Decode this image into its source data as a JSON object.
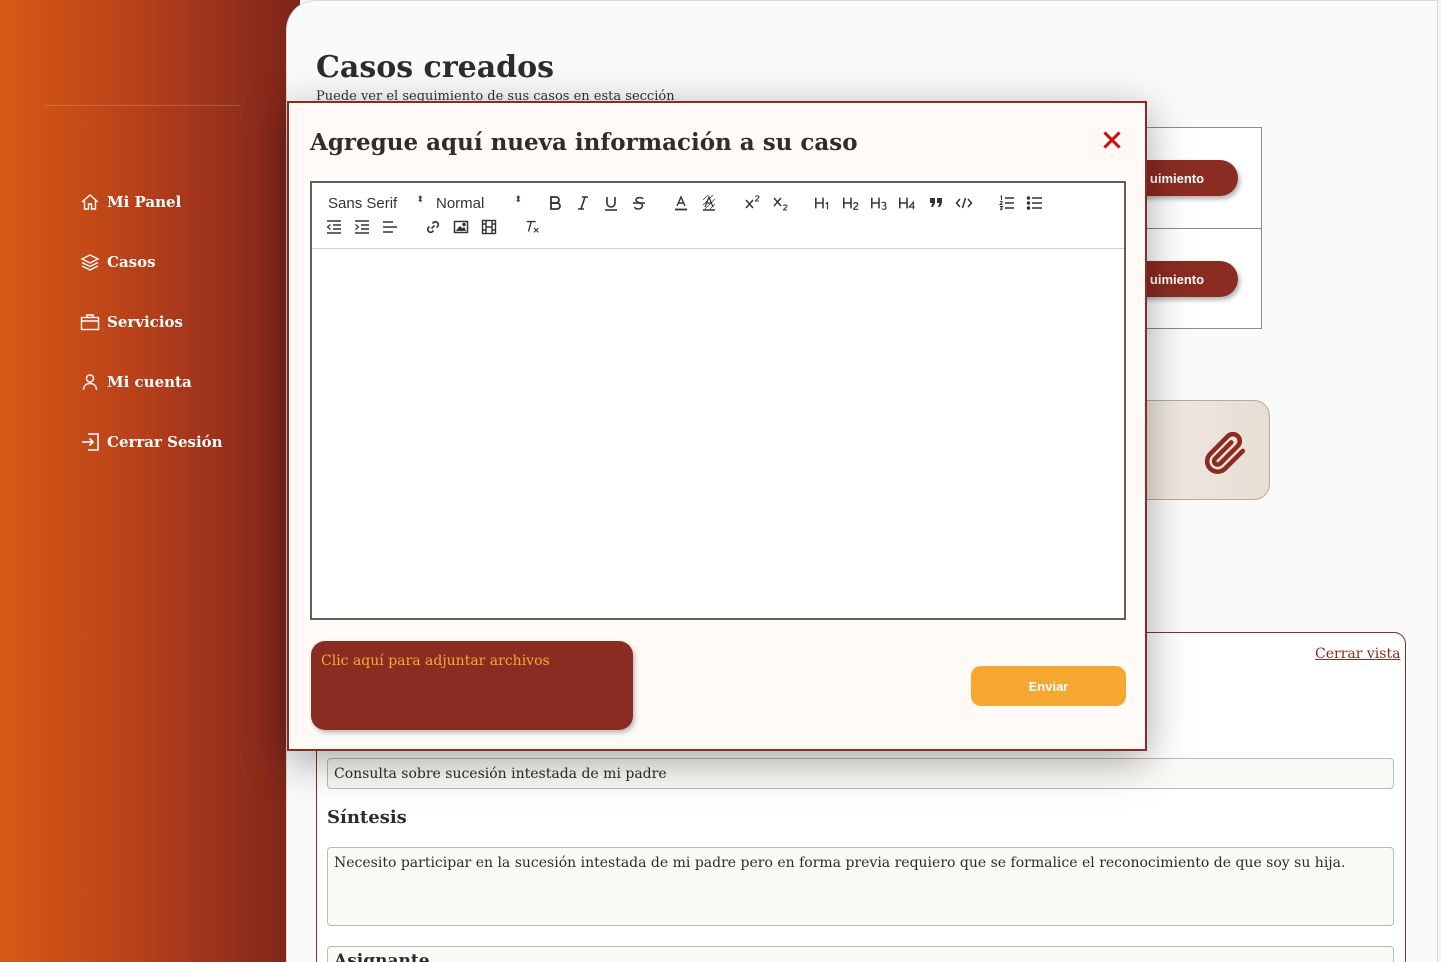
{
  "sidebar": {
    "items": [
      {
        "label": "Mi Panel",
        "icon": "home-icon"
      },
      {
        "label": "Casos",
        "icon": "layers-icon"
      },
      {
        "label": "Servicios",
        "icon": "briefcase-icon"
      },
      {
        "label": "Mi cuenta",
        "icon": "user-icon"
      },
      {
        "label": "Cerrar Sesión",
        "icon": "logout-icon"
      }
    ]
  },
  "main": {
    "title": "Casos creados",
    "subtitle": "Puede ver el seguimiento de sus casos en esta sección",
    "cases": [
      {
        "button_label": "uimiento"
      },
      {
        "button_label": "uimiento"
      }
    ],
    "attach_icon": "paperclip-icon",
    "detail": {
      "close_view": "Cerrar vista",
      "subject": "Consulta sobre sucesión intestada de mi padre",
      "synthesis_label": "Síntesis",
      "synthesis": "Necesito participar en la sucesión intestada de mi padre pero en forma previa requiero que se formalice el reconocimiento de que soy su hija.",
      "next_label": "Asignante"
    }
  },
  "modal": {
    "title": "Agregue aquí nueva información a su caso",
    "close_icon": "close-x-icon",
    "toolbar": {
      "font": "Sans Serif",
      "size": "Normal",
      "caret": "⬍"
    },
    "editor_content": "",
    "attach_label": "Clic aquí para adjuntar archivos",
    "send_label": "Enviar"
  },
  "colors": {
    "brand": "#8b2c22",
    "accent": "#f5a72f",
    "sidebar_start": "#d85a14",
    "sidebar_end": "#7a2418"
  }
}
